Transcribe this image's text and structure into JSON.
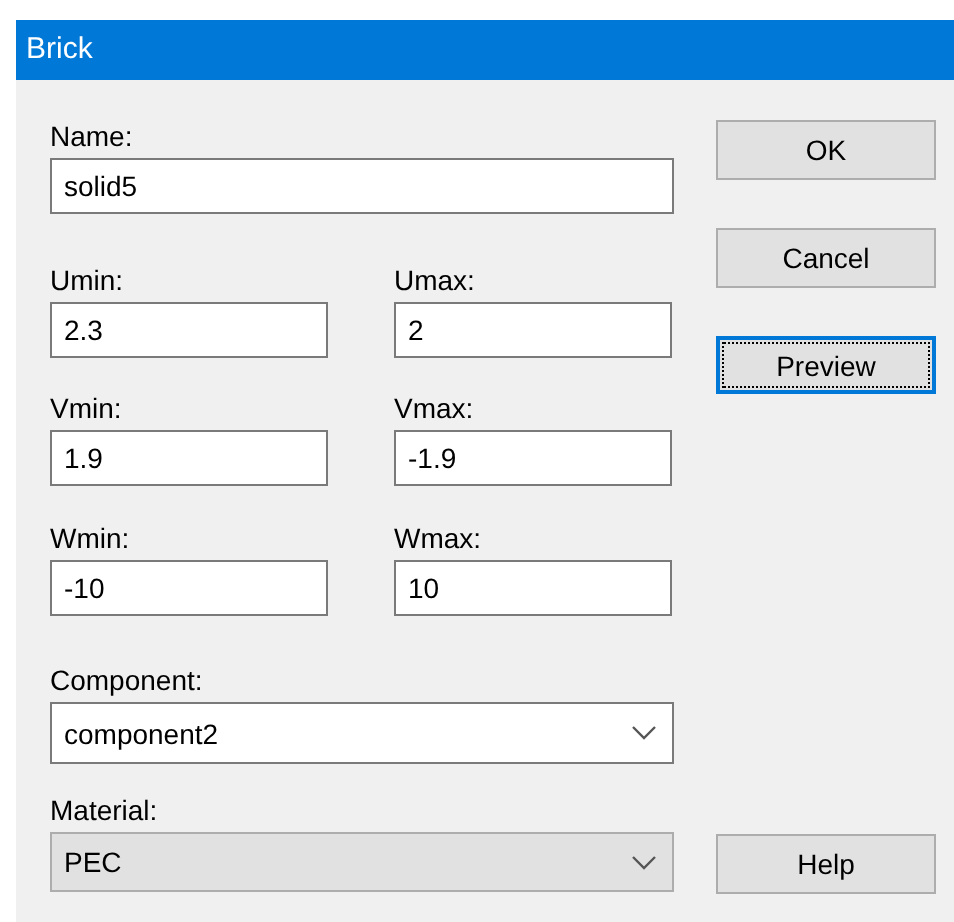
{
  "window": {
    "title": "Brick"
  },
  "name": {
    "label": "Name:",
    "value": "solid5"
  },
  "ranges": [
    {
      "min": {
        "label": "Umin:",
        "value": "2.3"
      },
      "max": {
        "label": "Umax:",
        "value": "2"
      }
    },
    {
      "min": {
        "label": "Vmin:",
        "value": "1.9"
      },
      "max": {
        "label": "Vmax:",
        "value": "-1.9"
      }
    },
    {
      "min": {
        "label": "Wmin:",
        "value": "-10"
      },
      "max": {
        "label": "Wmax:",
        "value": "10"
      }
    }
  ],
  "component": {
    "label": "Component:",
    "value": "component2",
    "disabled": false
  },
  "material": {
    "label": "Material:",
    "value": "PEC",
    "disabled": true
  },
  "buttons": [
    {
      "label": "OK",
      "focused": false
    },
    {
      "label": "Cancel",
      "focused": false
    },
    {
      "label": "Preview",
      "focused": true
    }
  ],
  "help_button": {
    "label": "Help",
    "focused": false
  }
}
